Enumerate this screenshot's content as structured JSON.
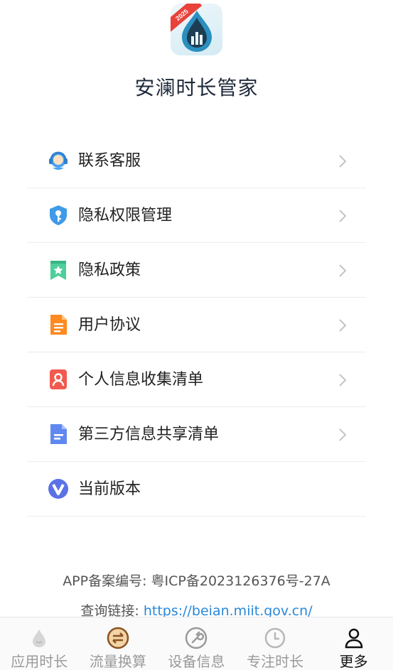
{
  "app": {
    "title": "安澜时长管家",
    "badge_text": "2025"
  },
  "menu": [
    {
      "label": "联系客服",
      "icon": "customer-service-icon"
    },
    {
      "label": "隐私权限管理",
      "icon": "shield-key-icon"
    },
    {
      "label": "隐私政策",
      "icon": "bookmark-star-icon"
    },
    {
      "label": "用户协议",
      "icon": "document-icon"
    },
    {
      "label": "个人信息收集清单",
      "icon": "user-card-icon"
    },
    {
      "label": "第三方信息共享清单",
      "icon": "file-icon"
    },
    {
      "label": "当前版本",
      "icon": "version-v-icon"
    }
  ],
  "footer": {
    "record_label": "APP备案编号: 粤ICP备2023126376号-27A",
    "query_label": "查询链接: ",
    "query_link": "https://beian.miit.gov.cn/"
  },
  "tabs": [
    {
      "label": "应用时长",
      "icon": "water-drop-icon",
      "active": false
    },
    {
      "label": "流量换算",
      "icon": "swap-arrows-icon",
      "active": false
    },
    {
      "label": "设备信息",
      "icon": "wrench-icon",
      "active": false
    },
    {
      "label": "专注时长",
      "icon": "clock-icon",
      "active": false
    },
    {
      "label": "更多",
      "icon": "user-icon",
      "active": true
    }
  ],
  "colors": {
    "accent_link": "#2a87d8",
    "badge": "#e8423a",
    "title": "#1f2a3a"
  }
}
